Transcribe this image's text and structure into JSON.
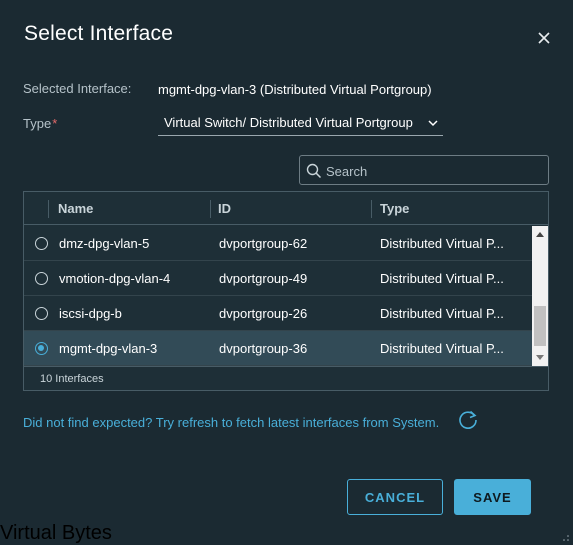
{
  "dialog": {
    "title": "Select Interface",
    "selected_label": "Selected Interface:",
    "selected_value": "mgmt-dpg-vlan-3 (Distributed Virtual Portgroup)",
    "type_label": "Type",
    "type_required_mark": "*",
    "type_value": "Virtual Switch/ Distributed Virtual Portgroup",
    "search_placeholder": "Search",
    "search_value": ""
  },
  "table": {
    "headers": {
      "name": "Name",
      "id": "ID",
      "type": "Type"
    },
    "rows": [
      {
        "name": "dmz-dpg-vlan-5",
        "id": "dvportgroup-62",
        "type": "Distributed Virtual P...",
        "selected": false
      },
      {
        "name": "vmotion-dpg-vlan-4",
        "id": "dvportgroup-49",
        "type": "Distributed Virtual P...",
        "selected": false
      },
      {
        "name": "iscsi-dpg-b",
        "id": "dvportgroup-26",
        "type": "Distributed Virtual P...",
        "selected": false
      },
      {
        "name": "mgmt-dpg-vlan-3",
        "id": "dvportgroup-36",
        "type": "Distributed Virtual P...",
        "selected": true
      }
    ],
    "footer": "10 Interfaces"
  },
  "hint": "Did not find expected? Try refresh to fetch latest interfaces from System.",
  "buttons": {
    "cancel": "CANCEL",
    "save": "SAVE"
  },
  "watermark": "Virtual Bytes",
  "icons": {
    "close": "close-icon",
    "chevron": "chevron-down-icon",
    "search": "search-icon",
    "refresh": "refresh-icon"
  },
  "colors": {
    "background": "#1b2a32",
    "accent": "#49afd9",
    "selected_row": "#324b57",
    "required": "#e46a6a"
  }
}
